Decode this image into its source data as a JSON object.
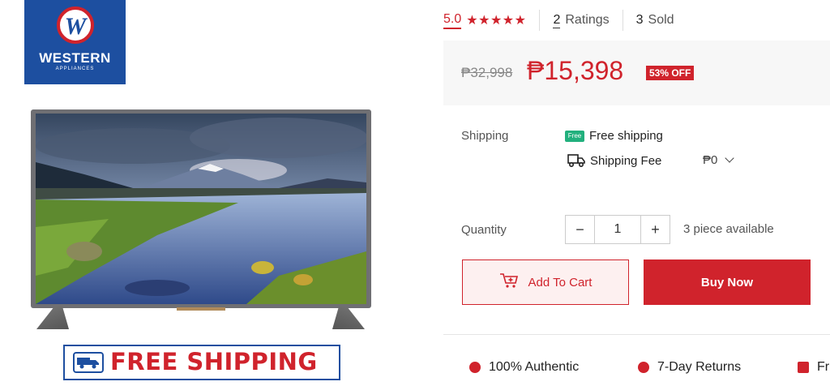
{
  "brand": {
    "name": "WESTERN",
    "sub": "APPLIANCES",
    "mark": "W",
    "color": "#1d4fa0"
  },
  "accent": "#d0232c",
  "banner": {
    "text": "FREE SHIPPING",
    "icon": "truck-icon"
  },
  "rating": {
    "value": "5.0",
    "stars": "★★★★★",
    "ratings_count": "2",
    "ratings_label": "Ratings",
    "sold_count": "3",
    "sold_label": "Sold"
  },
  "price": {
    "original": "₱32,998",
    "current": "₱15,398",
    "discount": "53% OFF"
  },
  "shipping": {
    "label": "Shipping",
    "free_badge": "Free",
    "free_text": "Free shipping",
    "fee_label": "Shipping Fee",
    "fee_value": "₱0"
  },
  "quantity": {
    "label": "Quantity",
    "minus": "−",
    "value": "1",
    "plus": "+",
    "available": "3 piece available"
  },
  "actions": {
    "add_to_cart": "Add To Cart",
    "buy_now": "Buy Now"
  },
  "features": [
    {
      "label": "100% Authentic",
      "icon": "shield-icon"
    },
    {
      "label": "7-Day Returns",
      "icon": "return-icon"
    },
    {
      "label": "Fr",
      "icon": "truck-icon"
    }
  ]
}
